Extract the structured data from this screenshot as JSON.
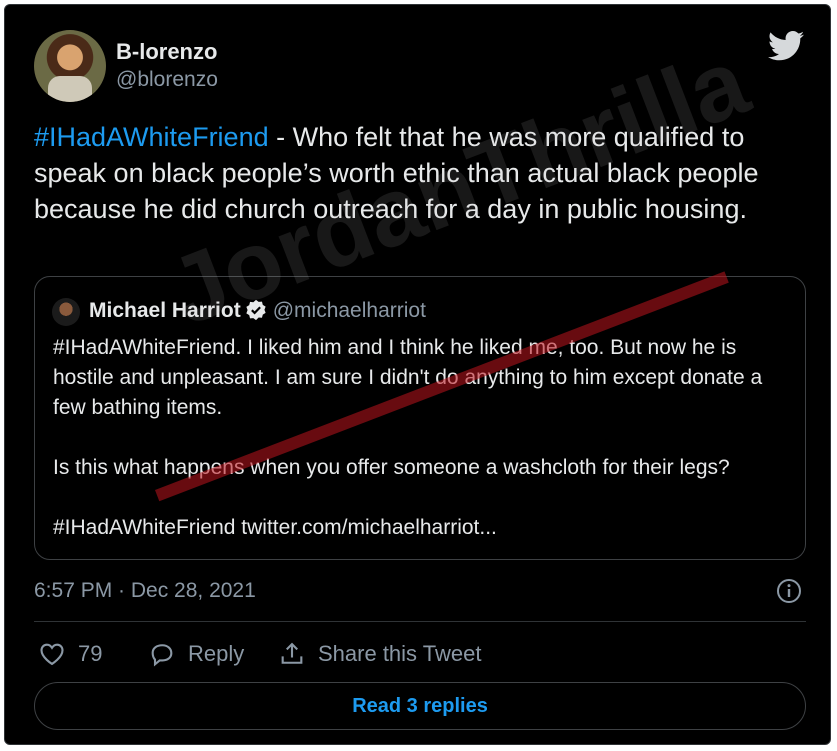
{
  "tweet": {
    "display_name": "B-lorenzo",
    "handle": "@blorenzo",
    "hashtag": "#IHadAWhiteFriend",
    "text": " - Who felt that he was more qualified to speak on black people’s worth ethic than actual black people because he did church outreach for a day in public housing.",
    "timestamp": "6:57 PM · Dec 28, 2021"
  },
  "quote": {
    "name": "Michael Harriot",
    "handle": "@michaelharriot",
    "text": "#IHadAWhiteFriend. I liked him and I think he liked me, too. But now he is hostile and unpleasant. I am sure I didn't do anything to him except donate a few bathing items.\n\nIs this what happens when you offer someone a washcloth for their legs?\n\n#IHadAWhiteFriend twitter.com/michaelharriot..."
  },
  "actions": {
    "like_count": "79",
    "reply_label": "Reply",
    "share_label": "Share this Tweet"
  },
  "read_replies_label": "Read 3 replies",
  "watermark": "JordanThrilla",
  "icons": {
    "brand": "twitter-bird-icon",
    "like": "heart-icon",
    "reply": "speech-bubble-icon",
    "share": "share-icon",
    "info": "info-icon",
    "verified": "verified-badge-icon"
  },
  "colors": {
    "background": "#000000",
    "text": "#e7e9ea",
    "muted": "#8b98a5",
    "accent": "#1d9bf0",
    "border": "#2f3336"
  }
}
